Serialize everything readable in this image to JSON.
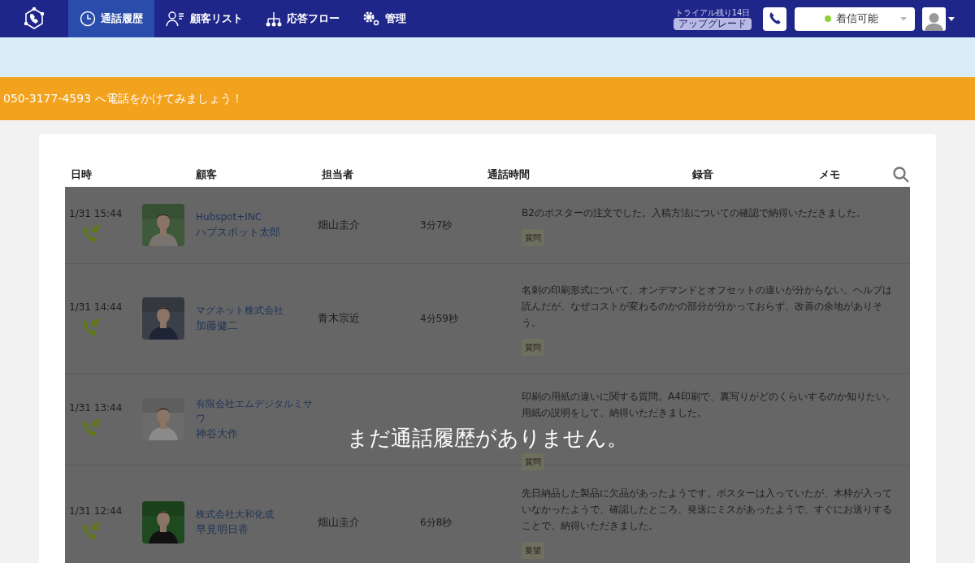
{
  "nav": {
    "items": [
      {
        "label": "通話履歴",
        "selected": true
      },
      {
        "label": "顧客リスト",
        "selected": false
      },
      {
        "label": "応答フロー",
        "selected": false
      },
      {
        "label": "管理",
        "selected": false
      }
    ],
    "trial": "トライアル残り14日",
    "upgrade": "アップグレード",
    "status": {
      "label": "着信可能",
      "color": "#8cd13b"
    }
  },
  "banner": "050-3177-4593 へ電話をかけてみましょう！",
  "table": {
    "columns": [
      "日時",
      "顧客",
      "担当者",
      "通話時間",
      "録音",
      "メモ"
    ],
    "rows": [
      {
        "datetime": "1/31 15:44",
        "company": "Hubspot+INC",
        "name": "ハブスポット太郎",
        "assignee": "畑山圭介",
        "duration": "3分7秒",
        "memo": "B2のポスターの注文でした。入稿方法についての確認で納得いただきました。",
        "tag": "質問"
      },
      {
        "datetime": "1/31 14:44",
        "company": "マグネット株式会社",
        "name": "加藤健二",
        "assignee": "青木宗近",
        "duration": "4分59秒",
        "memo": "名刺の印刷形式について、オンデマンドとオフセットの違いが分からない。ヘルプは読んだが、なぜコストが変わるのかの部分が分かっておらず、改善の余地がありそう。",
        "tag": "質問"
      },
      {
        "datetime": "1/31 13:44",
        "company": "有限会社エムデジタルミサワ",
        "name": "神谷大作",
        "memo": "印刷の用紙の違いに関する質問。A4印刷で、裏写りがどのくらいするのか知りたい。用紙の説明をして、納得いただきました。",
        "tag": "質問"
      },
      {
        "datetime": "1/31 12:44",
        "company": "株式会社大和化成",
        "name": "早見明日香",
        "assignee": "畑山圭介",
        "duration": "6分8秒",
        "memo": "先日納品した製品に欠品があったようです。ポスターは入っていたが、木枠が入っていなかったようで、確認したところ、発送にミスがあったようで、すぐにお送りすることで、納得いただきました。",
        "tag": "要望"
      }
    ]
  },
  "overlay": "まだ通話履歴がありません。"
}
